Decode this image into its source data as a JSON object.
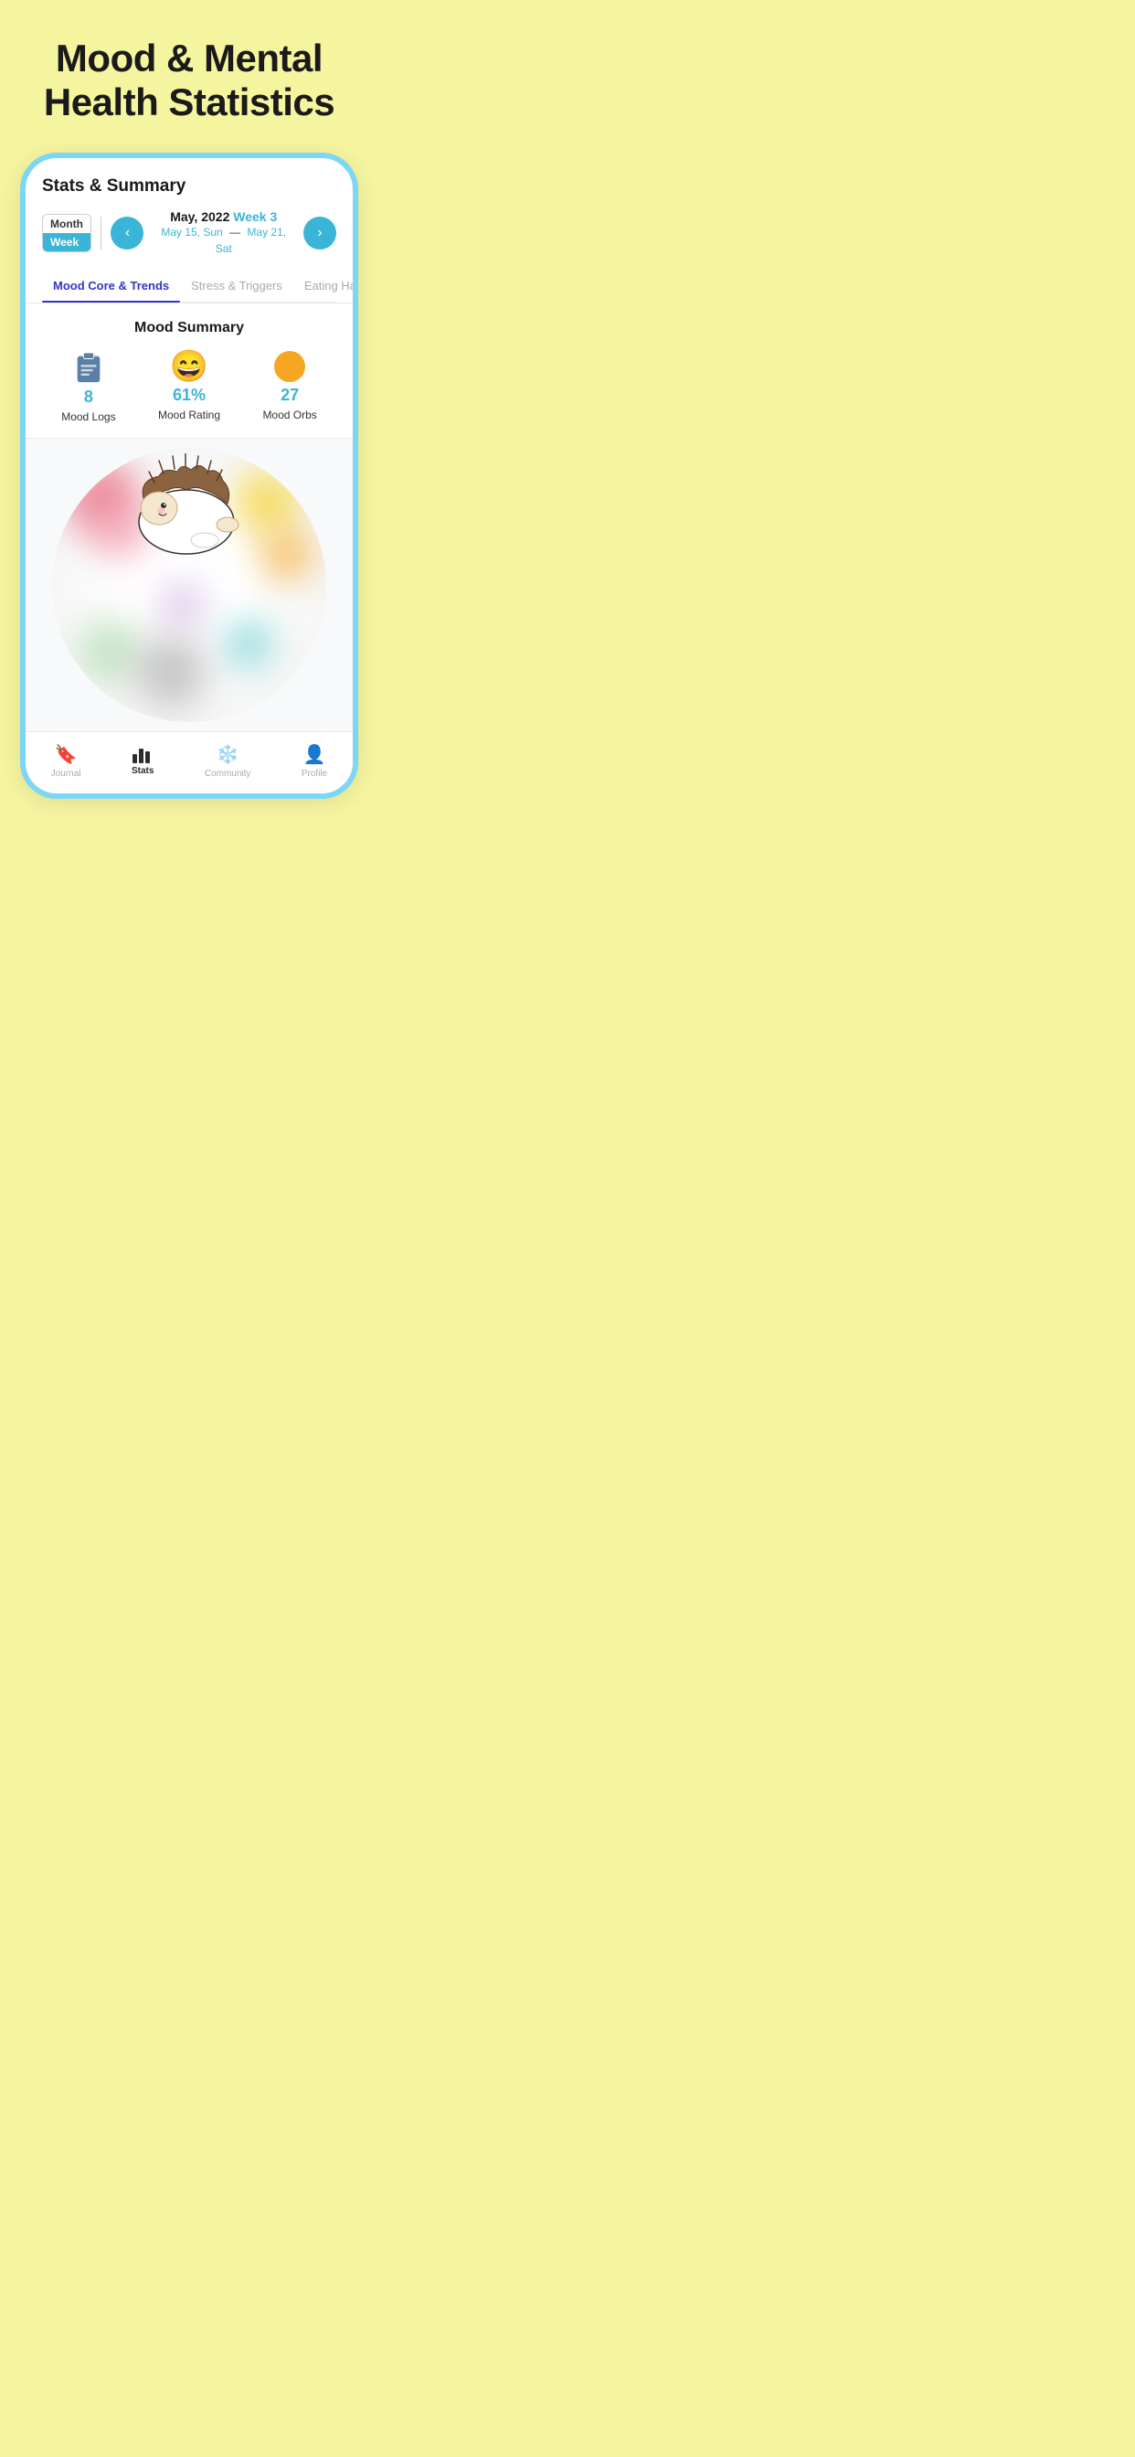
{
  "hero": {
    "title": "Mood & Mental Health Statistics"
  },
  "header": {
    "title": "Stats & Summary",
    "toggle": {
      "month_label": "Month",
      "week_label": "Week"
    },
    "date": {
      "month_year": "May, 2022",
      "week_label": "Week 3",
      "start": "May 15, Sun",
      "dash": "—",
      "end": "May 21, Sat"
    },
    "nav_prev": "‹",
    "nav_next": "›"
  },
  "tabs": [
    {
      "label": "Mood Core & Trends",
      "active": true
    },
    {
      "label": "Stress & Triggers",
      "active": false
    },
    {
      "label": "Eating Habits",
      "active": false
    }
  ],
  "mood_summary": {
    "title": "Mood Summary",
    "stats": [
      {
        "id": "logs",
        "value": "8",
        "label": "Mood Logs"
      },
      {
        "id": "rating",
        "value": "61%",
        "label": "Mood Rating"
      },
      {
        "id": "orbs",
        "value": "27",
        "label": "Mood Orbs"
      }
    ]
  },
  "bottom_nav": [
    {
      "id": "journal",
      "label": "Journal",
      "active": false
    },
    {
      "id": "stats",
      "label": "Stats",
      "active": true
    },
    {
      "id": "community",
      "label": "Community",
      "active": false
    },
    {
      "id": "profile",
      "label": "Profile",
      "active": false
    }
  ]
}
